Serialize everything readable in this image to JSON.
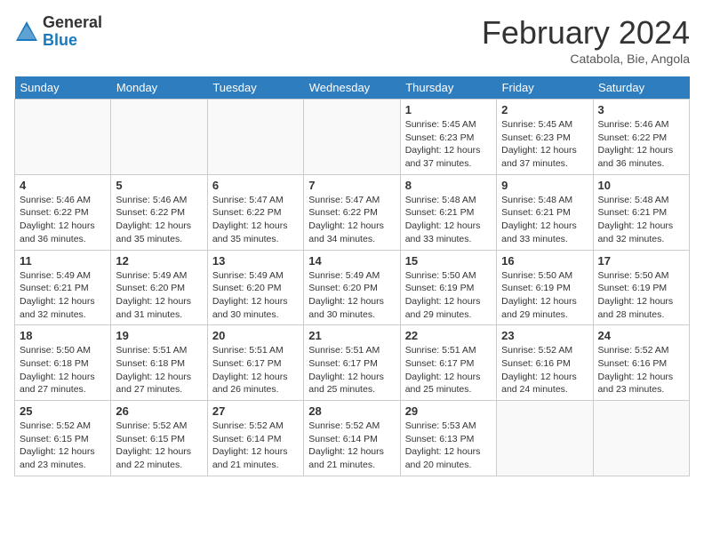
{
  "logo": {
    "general": "General",
    "blue": "Blue"
  },
  "title": "February 2024",
  "location": "Catabola, Bie, Angola",
  "days_of_week": [
    "Sunday",
    "Monday",
    "Tuesday",
    "Wednesday",
    "Thursday",
    "Friday",
    "Saturday"
  ],
  "weeks": [
    [
      {
        "day": "",
        "info": ""
      },
      {
        "day": "",
        "info": ""
      },
      {
        "day": "",
        "info": ""
      },
      {
        "day": "",
        "info": ""
      },
      {
        "day": "1",
        "info": "Sunrise: 5:45 AM\nSunset: 6:23 PM\nDaylight: 12 hours\nand 37 minutes."
      },
      {
        "day": "2",
        "info": "Sunrise: 5:45 AM\nSunset: 6:23 PM\nDaylight: 12 hours\nand 37 minutes."
      },
      {
        "day": "3",
        "info": "Sunrise: 5:46 AM\nSunset: 6:22 PM\nDaylight: 12 hours\nand 36 minutes."
      }
    ],
    [
      {
        "day": "4",
        "info": "Sunrise: 5:46 AM\nSunset: 6:22 PM\nDaylight: 12 hours\nand 36 minutes."
      },
      {
        "day": "5",
        "info": "Sunrise: 5:46 AM\nSunset: 6:22 PM\nDaylight: 12 hours\nand 35 minutes."
      },
      {
        "day": "6",
        "info": "Sunrise: 5:47 AM\nSunset: 6:22 PM\nDaylight: 12 hours\nand 35 minutes."
      },
      {
        "day": "7",
        "info": "Sunrise: 5:47 AM\nSunset: 6:22 PM\nDaylight: 12 hours\nand 34 minutes."
      },
      {
        "day": "8",
        "info": "Sunrise: 5:48 AM\nSunset: 6:21 PM\nDaylight: 12 hours\nand 33 minutes."
      },
      {
        "day": "9",
        "info": "Sunrise: 5:48 AM\nSunset: 6:21 PM\nDaylight: 12 hours\nand 33 minutes."
      },
      {
        "day": "10",
        "info": "Sunrise: 5:48 AM\nSunset: 6:21 PM\nDaylight: 12 hours\nand 32 minutes."
      }
    ],
    [
      {
        "day": "11",
        "info": "Sunrise: 5:49 AM\nSunset: 6:21 PM\nDaylight: 12 hours\nand 32 minutes."
      },
      {
        "day": "12",
        "info": "Sunrise: 5:49 AM\nSunset: 6:20 PM\nDaylight: 12 hours\nand 31 minutes."
      },
      {
        "day": "13",
        "info": "Sunrise: 5:49 AM\nSunset: 6:20 PM\nDaylight: 12 hours\nand 30 minutes."
      },
      {
        "day": "14",
        "info": "Sunrise: 5:49 AM\nSunset: 6:20 PM\nDaylight: 12 hours\nand 30 minutes."
      },
      {
        "day": "15",
        "info": "Sunrise: 5:50 AM\nSunset: 6:19 PM\nDaylight: 12 hours\nand 29 minutes."
      },
      {
        "day": "16",
        "info": "Sunrise: 5:50 AM\nSunset: 6:19 PM\nDaylight: 12 hours\nand 29 minutes."
      },
      {
        "day": "17",
        "info": "Sunrise: 5:50 AM\nSunset: 6:19 PM\nDaylight: 12 hours\nand 28 minutes."
      }
    ],
    [
      {
        "day": "18",
        "info": "Sunrise: 5:50 AM\nSunset: 6:18 PM\nDaylight: 12 hours\nand 27 minutes."
      },
      {
        "day": "19",
        "info": "Sunrise: 5:51 AM\nSunset: 6:18 PM\nDaylight: 12 hours\nand 27 minutes."
      },
      {
        "day": "20",
        "info": "Sunrise: 5:51 AM\nSunset: 6:17 PM\nDaylight: 12 hours\nand 26 minutes."
      },
      {
        "day": "21",
        "info": "Sunrise: 5:51 AM\nSunset: 6:17 PM\nDaylight: 12 hours\nand 25 minutes."
      },
      {
        "day": "22",
        "info": "Sunrise: 5:51 AM\nSunset: 6:17 PM\nDaylight: 12 hours\nand 25 minutes."
      },
      {
        "day": "23",
        "info": "Sunrise: 5:52 AM\nSunset: 6:16 PM\nDaylight: 12 hours\nand 24 minutes."
      },
      {
        "day": "24",
        "info": "Sunrise: 5:52 AM\nSunset: 6:16 PM\nDaylight: 12 hours\nand 23 minutes."
      }
    ],
    [
      {
        "day": "25",
        "info": "Sunrise: 5:52 AM\nSunset: 6:15 PM\nDaylight: 12 hours\nand 23 minutes."
      },
      {
        "day": "26",
        "info": "Sunrise: 5:52 AM\nSunset: 6:15 PM\nDaylight: 12 hours\nand 22 minutes."
      },
      {
        "day": "27",
        "info": "Sunrise: 5:52 AM\nSunset: 6:14 PM\nDaylight: 12 hours\nand 21 minutes."
      },
      {
        "day": "28",
        "info": "Sunrise: 5:52 AM\nSunset: 6:14 PM\nDaylight: 12 hours\nand 21 minutes."
      },
      {
        "day": "29",
        "info": "Sunrise: 5:53 AM\nSunset: 6:13 PM\nDaylight: 12 hours\nand 20 minutes."
      },
      {
        "day": "",
        "info": ""
      },
      {
        "day": "",
        "info": ""
      }
    ]
  ]
}
